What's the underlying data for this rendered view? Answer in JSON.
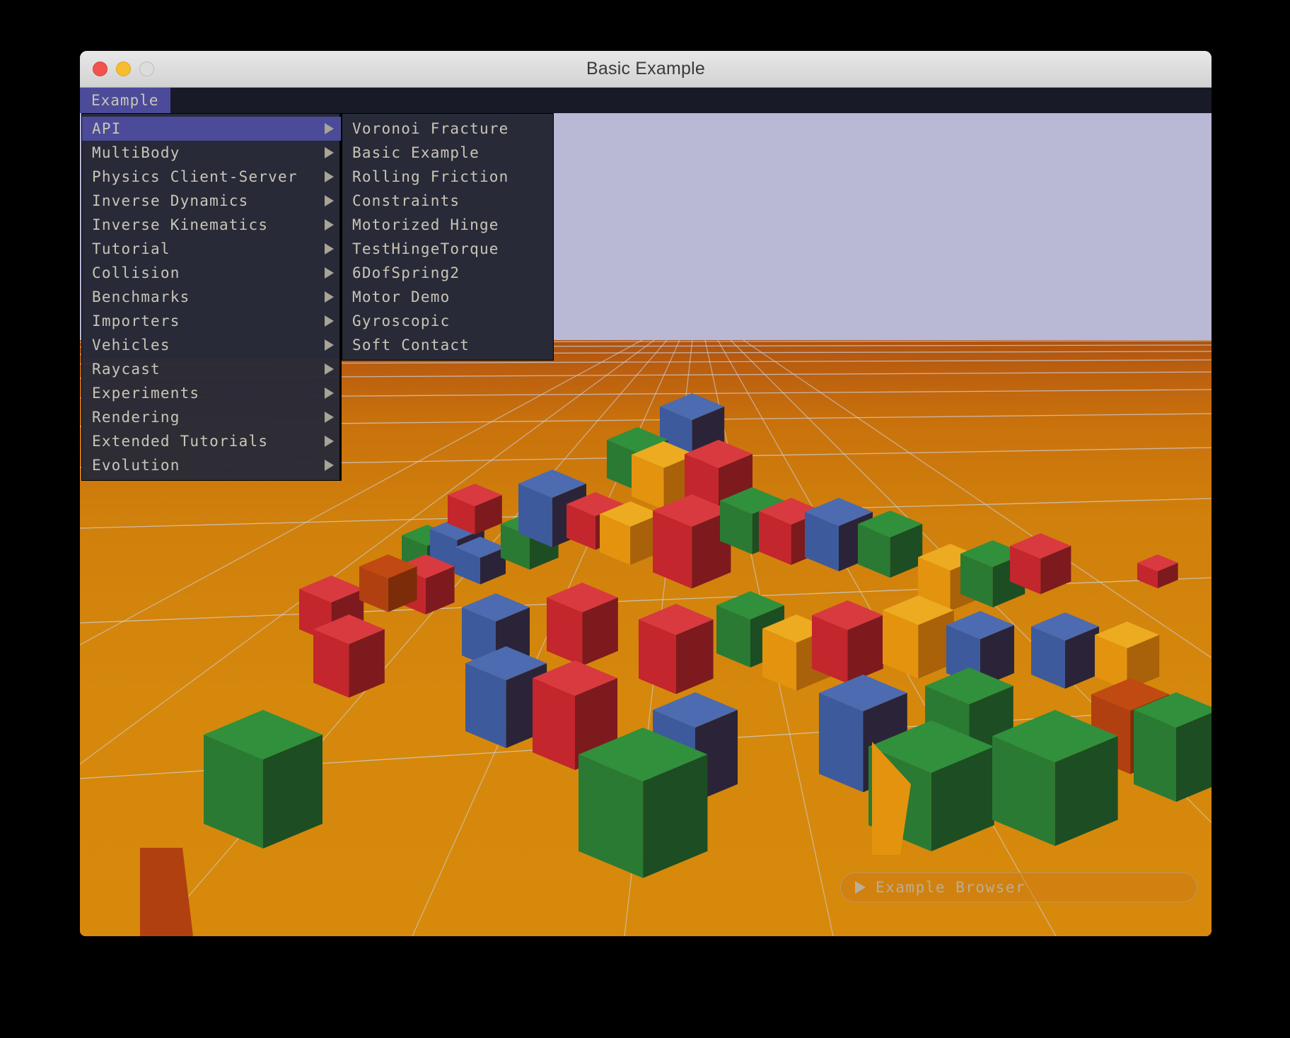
{
  "window": {
    "title": "Basic Example",
    "traffic_lights": [
      "close",
      "minimize",
      "zoom"
    ]
  },
  "menubar": {
    "root_label": "Example"
  },
  "menu_main": {
    "items": [
      {
        "label": "API",
        "has_submenu": true,
        "selected": true
      },
      {
        "label": "MultiBody",
        "has_submenu": true,
        "selected": false
      },
      {
        "label": "Physics Client-Server",
        "has_submenu": true,
        "selected": false
      },
      {
        "label": "Inverse Dynamics",
        "has_submenu": true,
        "selected": false
      },
      {
        "label": "Inverse Kinematics",
        "has_submenu": true,
        "selected": false
      },
      {
        "label": "Tutorial",
        "has_submenu": true,
        "selected": false
      },
      {
        "label": "Collision",
        "has_submenu": true,
        "selected": false
      },
      {
        "label": "Benchmarks",
        "has_submenu": true,
        "selected": false
      },
      {
        "label": "Importers",
        "has_submenu": true,
        "selected": false
      },
      {
        "label": "Vehicles",
        "has_submenu": true,
        "selected": false
      },
      {
        "label": "Raycast",
        "has_submenu": true,
        "selected": false
      },
      {
        "label": "Experiments",
        "has_submenu": true,
        "selected": false
      },
      {
        "label": "Rendering",
        "has_submenu": true,
        "selected": false
      },
      {
        "label": "Extended Tutorials",
        "has_submenu": true,
        "selected": false
      },
      {
        "label": "Evolution",
        "has_submenu": true,
        "selected": false
      }
    ]
  },
  "menu_sub": {
    "parent": "API",
    "items": [
      {
        "label": "Voronoi Fracture"
      },
      {
        "label": "Basic Example"
      },
      {
        "label": "Rolling Friction"
      },
      {
        "label": "Constraints"
      },
      {
        "label": "Motorized Hinge"
      },
      {
        "label": "TestHingeTorque"
      },
      {
        "label": "6DofSpring2"
      },
      {
        "label": "Motor Demo"
      },
      {
        "label": "Gyroscopic"
      },
      {
        "label": "Soft Contact"
      }
    ]
  },
  "example_browser": {
    "label": "Example Browser"
  },
  "scene": {
    "colors": {
      "sky": "#b9b9d6",
      "ground_near": "#d6890b",
      "ground_far": "#ae5310",
      "grid_line": "#cfd2dd",
      "cube_red": "#c3262c",
      "cube_blue": "#3d5a9c",
      "cube_green": "#2b7a33",
      "cube_orange": "#e4930f",
      "menu_bg": "#282a38",
      "menu_highlight": "#4b4b99",
      "menu_text": "#c9c5b6",
      "menubar_bg": "#191a28"
    }
  }
}
